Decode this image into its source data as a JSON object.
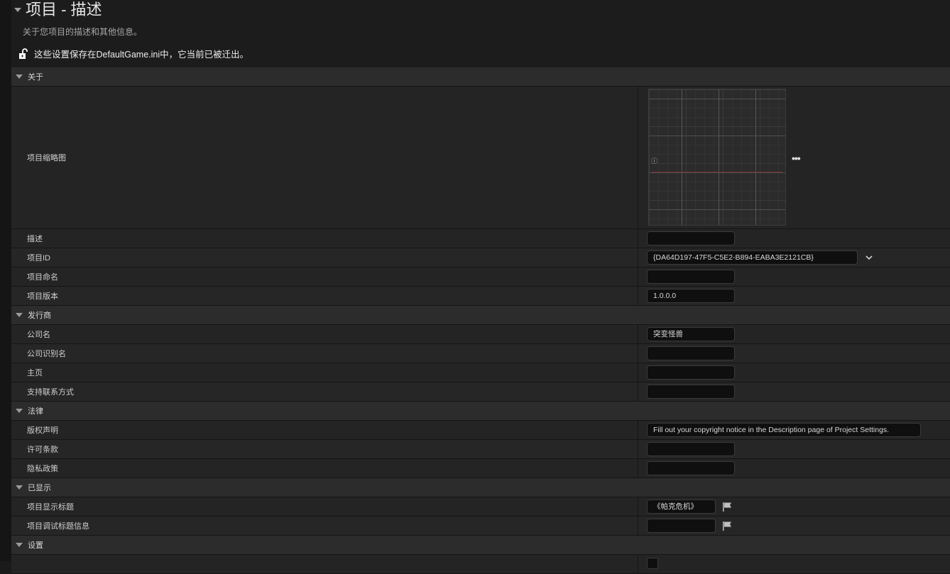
{
  "page": {
    "title": "项目 - 描述",
    "subtitle": "关于您项目的描述和其他信息。",
    "notice": "这些设置保存在DefaultGame.ini中，它当前已被迁出。"
  },
  "sections": {
    "about": {
      "label": "关于",
      "thumbnail_label": "项目缩略图",
      "thumbnail_glyph": "ⓘ",
      "description_label": "描述",
      "description_value": "",
      "project_id_label": "项目ID",
      "project_id_value": "{DA64D197-47F5-C5E2-B894-EABA3E2121CB}",
      "project_name_label": "项目命名",
      "project_name_value": "",
      "project_version_label": "项目版本",
      "project_version_value": "1.0.0.0"
    },
    "publisher": {
      "label": "发行商",
      "company_name_label": "公司名",
      "company_name_value": "突变怪兽",
      "company_distinguished_label": "公司识别名",
      "company_distinguished_value": "",
      "homepage_label": "主页",
      "homepage_value": "",
      "support_contact_label": "支持联系方式",
      "support_contact_value": ""
    },
    "legal": {
      "label": "法律",
      "copyright_label": "版权声明",
      "copyright_value": "Fill out your copyright notice in the Description page of Project Settings.",
      "licensing_label": "许可条款",
      "licensing_value": "",
      "privacy_label": "隐私政策",
      "privacy_value": ""
    },
    "displayed": {
      "label": "已显示",
      "display_title_label": "项目显示标题",
      "display_title_value": "《帕克危机》",
      "debug_title_label": "项目调试标题信息",
      "debug_title_value": ""
    },
    "settings": {
      "label": "设置"
    }
  },
  "icons": {
    "lock": "lock-open-icon",
    "more": "more-options-icon",
    "dropdown": "chevron-down-icon",
    "flag": "localization-flag-icon"
  },
  "colors": {
    "background": "#1a1a1a",
    "section_header": "#2c2c2c",
    "row": "#242424",
    "input_bg": "#0f0f0f"
  }
}
